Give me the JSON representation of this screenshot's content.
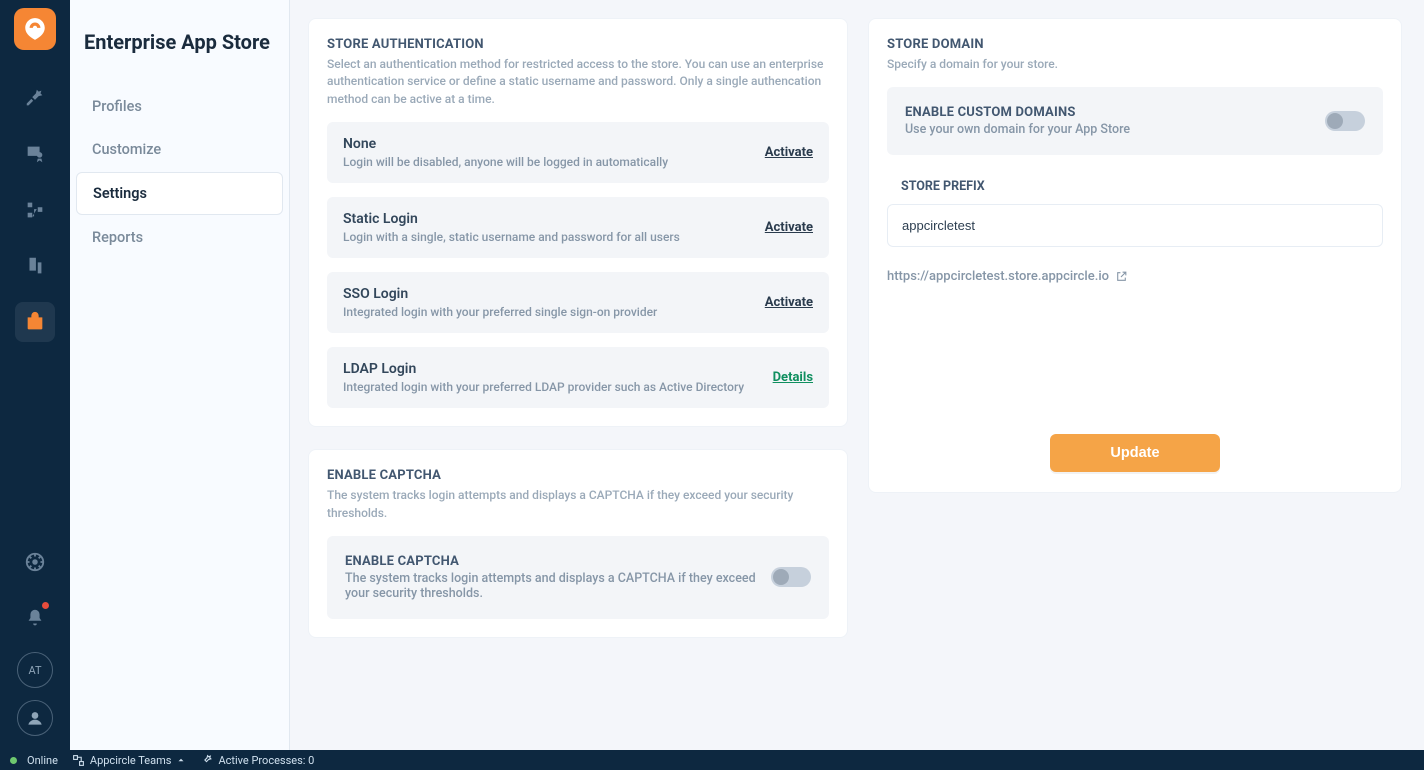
{
  "app": {
    "title": "Enterprise App Store"
  },
  "sidebar": {
    "items": [
      {
        "label": "Profiles"
      },
      {
        "label": "Customize"
      },
      {
        "label": "Settings"
      },
      {
        "label": "Reports"
      }
    ]
  },
  "auth": {
    "title": "STORE AUTHENTICATION",
    "sub": "Select an authentication method for restricted access to the store. You can use an enterprise authentication service or define a static username and password. Only a single authencation method can be active at a time.",
    "options": [
      {
        "title": "None",
        "desc": "Login will be disabled, anyone will be logged in automatically",
        "action": "Activate",
        "kind": "activate"
      },
      {
        "title": "Static Login",
        "desc": "Login with a single, static username and password for all users",
        "action": "Activate",
        "kind": "activate"
      },
      {
        "title": "SSO Login",
        "desc": "Integrated login with your preferred single sign-on provider",
        "action": "Activate",
        "kind": "activate"
      },
      {
        "title": "LDAP Login",
        "desc": "Integrated login with your preferred LDAP provider such as Active Directory",
        "action": "Details",
        "kind": "details"
      }
    ]
  },
  "captcha": {
    "panel_title": "ENABLE CAPTCHA",
    "panel_sub": "The system tracks login attempts and displays a CAPTCHA if they exceed your security thresholds.",
    "box_title": "ENABLE CAPTCHA",
    "box_sub": "The system tracks login attempts and displays a CAPTCHA if they exceed your security thresholds."
  },
  "domain": {
    "panel_title": "STORE DOMAIN",
    "panel_sub": "Specify a domain for your store.",
    "enable_title": "ENABLE CUSTOM DOMAINS",
    "enable_sub": "Use your own domain for your App Store",
    "prefix_label": "STORE PREFIX",
    "prefix_value": "appcircletest",
    "url": "https://appcircletest.store.appcircle.io",
    "update": "Update"
  },
  "statusbar": {
    "online": "Online",
    "team": "Appcircle Teams",
    "processes": "Active Processes: 0"
  },
  "avatar_initials": "AT"
}
